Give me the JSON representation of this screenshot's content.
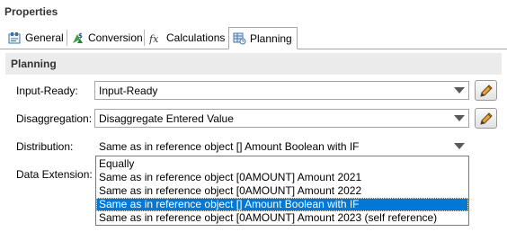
{
  "properties": {
    "title": "Properties"
  },
  "tabs": [
    {
      "label": "General",
      "icon": "general-icon",
      "active": false
    },
    {
      "label": "Conversion",
      "icon": "conversion-icon",
      "active": false
    },
    {
      "label": "Calculations",
      "icon": "fx-icon",
      "active": false
    },
    {
      "label": "Planning",
      "icon": "planning-icon",
      "active": true
    }
  ],
  "section": {
    "title": "Planning"
  },
  "fields": {
    "input_ready": {
      "label": "Input-Ready:",
      "value": "Input-Ready"
    },
    "disaggregation": {
      "label": "Disaggregation:",
      "value": "Disaggregate Entered Value"
    },
    "distribution": {
      "label": "Distribution:",
      "value": "Same as in reference object [] Amount Boolean with IF"
    },
    "data_extension": {
      "label": "Data Extension:"
    }
  },
  "dropdown": {
    "options": [
      "Equally",
      "Same as in reference object [0AMOUNT] Amount 2021",
      "Same as in reference object [0AMOUNT] Amount 2022",
      "Same as in reference object [] Amount Boolean with IF",
      "Same as in reference object [0AMOUNT] Amount 2023 (self reference)"
    ],
    "selected_index": 3
  },
  "colors": {
    "selection": "#0078d7",
    "section_bar": "#ebebeb",
    "pencil_orange": "#e8a33c"
  }
}
